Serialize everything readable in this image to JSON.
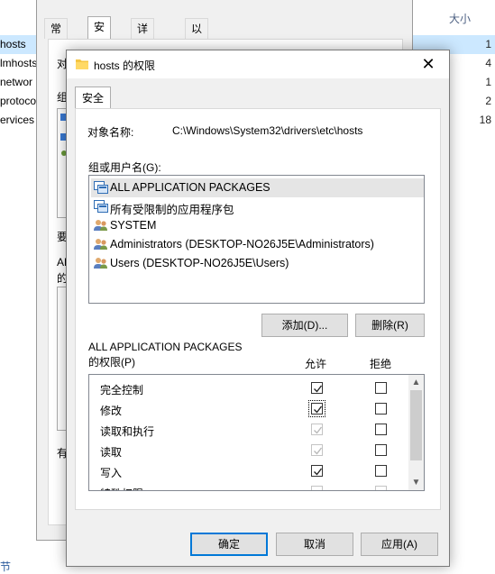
{
  "explorer": {
    "size_header": "大小",
    "rows": [
      {
        "name": "hosts",
        "size": "1",
        "selected": true
      },
      {
        "name": "lmhosts",
        "size": "4",
        "selected": false
      },
      {
        "name": "networ",
        "size": "1",
        "selected": false
      },
      {
        "name": "protoco",
        "size": "2",
        "selected": false
      },
      {
        "name": "ervices",
        "size": "18",
        "selected": false
      }
    ],
    "bottom_text": "节"
  },
  "props_dialog": {
    "tabs": [
      "常规",
      "安全",
      "详细信息",
      "以前的版本"
    ],
    "active_tab": "安全",
    "fragments": [
      "对",
      "组",
      "要",
      "AL",
      "的",
      "有"
    ]
  },
  "dialog": {
    "title": "hosts 的权限",
    "tab": "安全",
    "object_label": "对象名称:",
    "object_value": "C:\\Windows\\System32\\drivers\\etc\\hosts",
    "group_label": "组或用户名(G):",
    "users": [
      {
        "label": "ALL APPLICATION PACKAGES",
        "icon": "app-package-icon",
        "selected": true
      },
      {
        "label": "所有受限制的应用程序包",
        "icon": "app-package-icon",
        "selected": false
      },
      {
        "label": "SYSTEM",
        "icon": "user-group-icon",
        "selected": false
      },
      {
        "label": "Administrators (DESKTOP-NO26J5E\\Administrators)",
        "icon": "user-group-icon",
        "selected": false
      },
      {
        "label": "Users (DESKTOP-NO26J5E\\Users)",
        "icon": "user-group-icon",
        "selected": false
      }
    ],
    "add_button": "添加(D)...",
    "remove_button": "删除(R)",
    "perm_for_line1": "ALL APPLICATION PACKAGES",
    "perm_for_line2": "的权限(P)",
    "allow_header": "允许",
    "deny_header": "拒绝",
    "permissions": [
      {
        "name": "完全控制",
        "allow": true,
        "allow_disabled": false,
        "deny": false,
        "deny_disabled": false
      },
      {
        "name": "修改",
        "allow": true,
        "allow_disabled": false,
        "deny": false,
        "deny_disabled": false
      },
      {
        "name": "读取和执行",
        "allow": true,
        "allow_disabled": true,
        "deny": false,
        "deny_disabled": false
      },
      {
        "name": "读取",
        "allow": true,
        "allow_disabled": true,
        "deny": false,
        "deny_disabled": false
      },
      {
        "name": "写入",
        "allow": true,
        "allow_disabled": false,
        "deny": false,
        "deny_disabled": false
      },
      {
        "name": "特殊权限",
        "allow": false,
        "allow_disabled": true,
        "deny": false,
        "deny_disabled": true
      }
    ],
    "ok_button": "确定",
    "cancel_button": "取消",
    "apply_button": "应用(A)"
  }
}
